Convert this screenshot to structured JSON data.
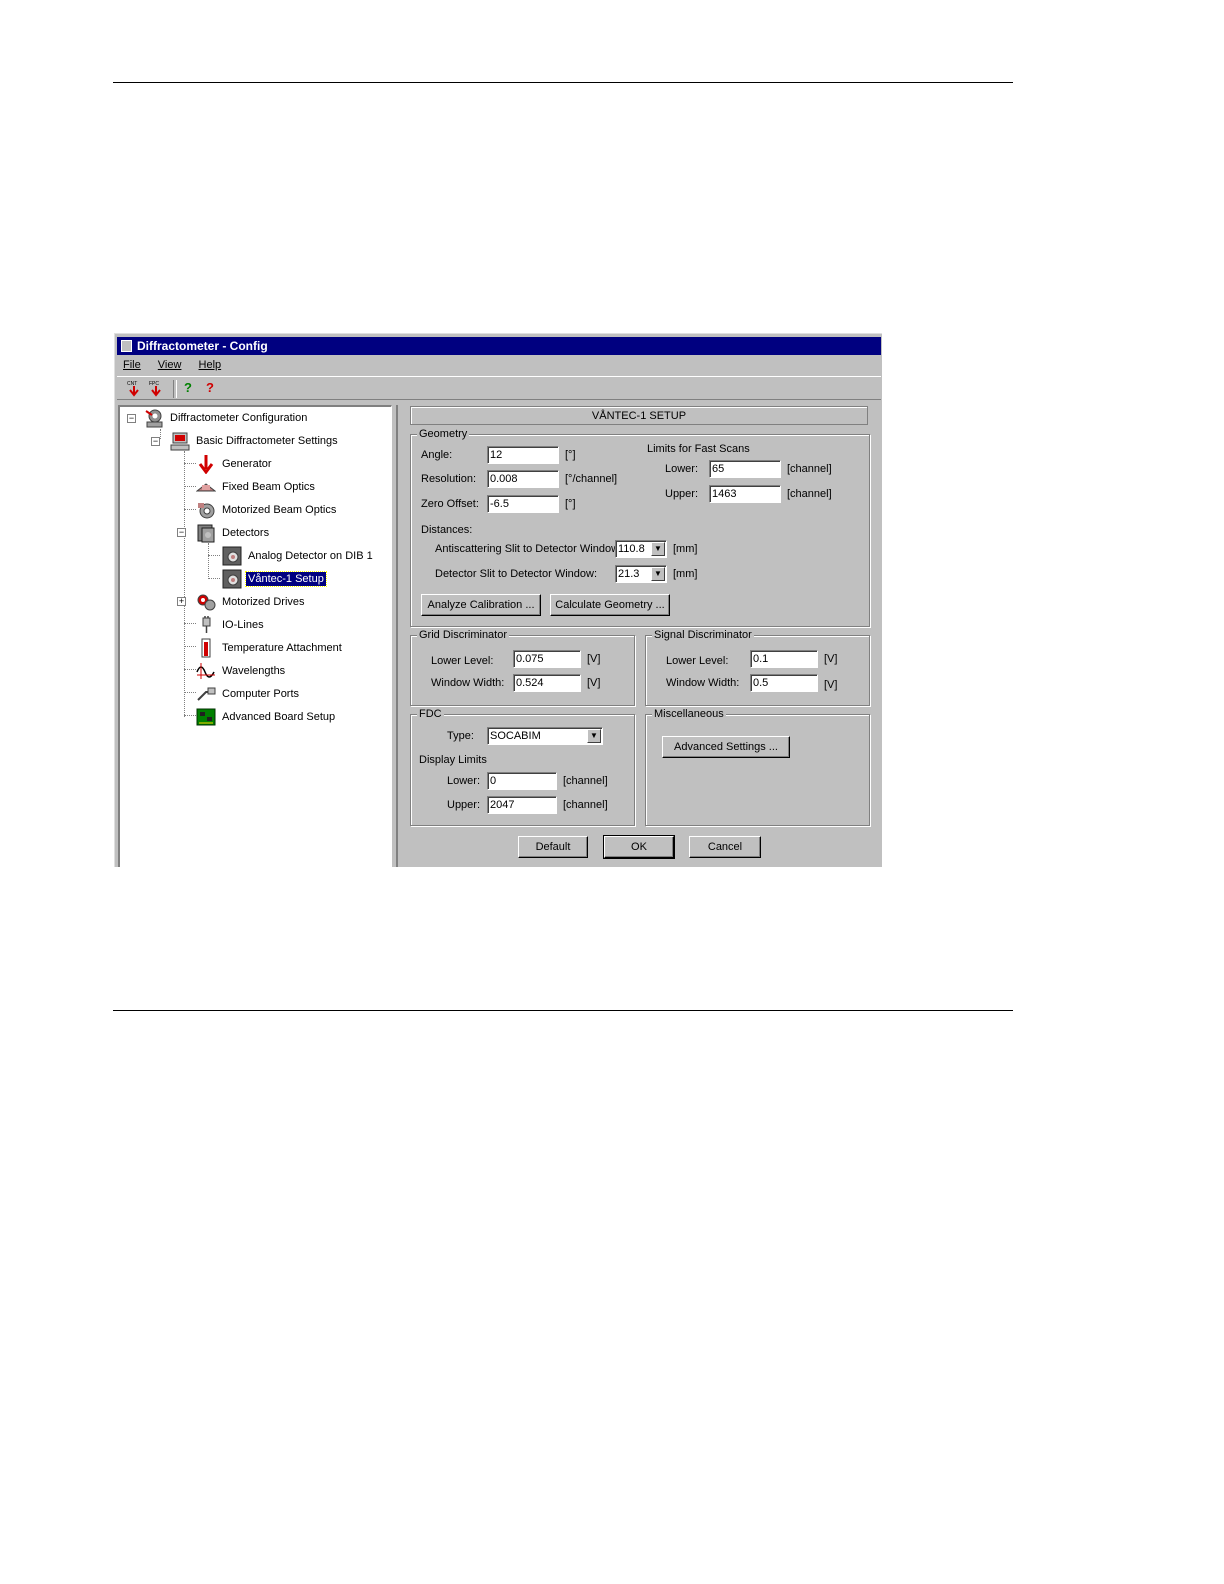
{
  "window": {
    "title": "Diffractometer - Config",
    "menu": [
      "File",
      "View",
      "Help"
    ],
    "toolbar": [
      {
        "icon": "download-cnt-icon",
        "text": "CNT"
      },
      {
        "icon": "download-fpc-icon",
        "text": "FPC"
      },
      {
        "icon": "help-icon",
        "text": "?"
      },
      {
        "icon": "context-help-icon",
        "text": "?"
      }
    ]
  },
  "tree": {
    "root": "Diffractometer Configuration",
    "basic": "Basic Diffractometer Settings",
    "generator": "Generator",
    "fixed_beam": "Fixed Beam Optics",
    "motorized_beam": "Motorized Beam Optics",
    "detectors": "Detectors",
    "analog_detector": "Analog Detector on DIB 1",
    "vantec_setup": "Våntec-1 Setup",
    "motorized_drives": "Motorized Drives",
    "io_lines": "IO-Lines",
    "temperature": "Temperature Attachment",
    "wavelengths": "Wavelengths",
    "computer_ports": "Computer Ports",
    "advanced_board": "Advanced Board Setup"
  },
  "panel": {
    "header": "VÅNTEC-1 SETUP",
    "geometry": {
      "legend": "Geometry",
      "angle_label": "Angle:",
      "angle_value": "12",
      "angle_unit": "[°]",
      "resolution_label": "Resolution:",
      "resolution_value": "0.008",
      "resolution_unit": "[°/channel]",
      "zero_offset_label": "Zero Offset:",
      "zero_offset_value": "-6.5",
      "zero_offset_unit": "[°]",
      "fast_scans_label": "Limits for Fast Scans",
      "lower_label": "Lower:",
      "lower_value": "65",
      "lower_unit": "[channel]",
      "upper_label": "Upper:",
      "upper_value": "1463",
      "upper_unit": "[channel]",
      "distances_label": "Distances:",
      "antiscatter_label": "Antiscattering Slit to Detector Window:",
      "antiscatter_value": "110.8",
      "antiscatter_unit": "[mm]",
      "detector_slit_label": "Detector Slit to Detector Window:",
      "detector_slit_value": "21.3",
      "detector_slit_unit": "[mm]",
      "analyze_button": "Analyze Calibration ...",
      "calculate_button": "Calculate Geometry ..."
    },
    "grid": {
      "legend": "Grid Discriminator",
      "lower_label": "Lower Level:",
      "lower_value": "0.075",
      "lower_unit": "[V]",
      "width_label": "Window Width:",
      "width_value": "0.524",
      "width_unit": "[V]"
    },
    "signal": {
      "legend": "Signal Discriminator",
      "lower_label": "Lower Level:",
      "lower_value": "0.1",
      "lower_unit": "[V]",
      "width_label": "Window Width:",
      "width_value": "0.5",
      "width_unit": "[V]"
    },
    "fdc": {
      "legend": "FDC",
      "type_label": "Type:",
      "type_value": "SOCABIM",
      "display_limits": "Display Limits",
      "lower_label": "Lower:",
      "lower_value": "0",
      "lower_unit": "[channel]",
      "upper_label": "Upper:",
      "upper_value": "2047",
      "upper_unit": "[channel]"
    },
    "misc": {
      "legend": "Miscellaneous",
      "advanced_button": "Advanced Settings ..."
    },
    "buttons": {
      "default": "Default",
      "ok": "OK",
      "cancel": "Cancel"
    }
  }
}
